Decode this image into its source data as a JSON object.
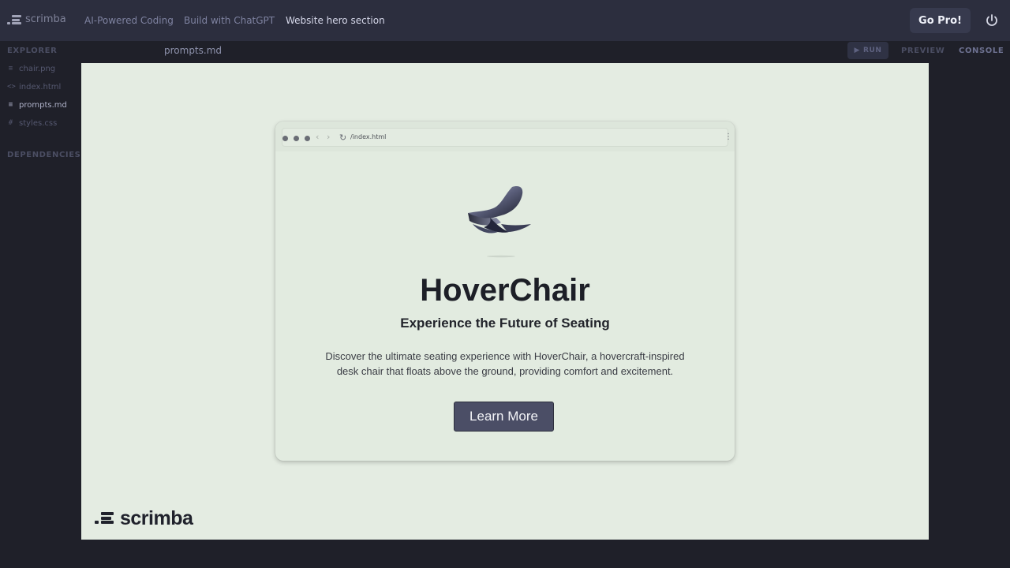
{
  "app": {
    "logo_text": "scrimba",
    "breadcrumbs": [
      "AI-Powered Coding",
      "Build with ChatGPT",
      "Website hero section"
    ],
    "go_pro_label": "Go Pro!",
    "power_icon": "power-icon"
  },
  "sidebar": {
    "explorer_label": "EXPLORER",
    "files": [
      {
        "icon": "≡",
        "name": "chair.png"
      },
      {
        "icon": "<>",
        "name": "index.html"
      },
      {
        "icon": "≡",
        "name": "prompts.md"
      },
      {
        "icon": "#",
        "name": "styles.css"
      }
    ],
    "dependencies_label": "DEPENDENCIES"
  },
  "editor": {
    "active_file": "prompts.md",
    "run_label": "RUN",
    "preview_label": "PREVIEW",
    "console_label": "CONSOLE"
  },
  "preview": {
    "browser": {
      "url": "/index.html"
    },
    "hero": {
      "title": "HoverChair",
      "subtitle": "Experience the Future of Seating",
      "description": "Discover the ultimate seating experience with HoverChair, a hovercraft-inspired desk chair that floats above the ground, providing comfort and excitement.",
      "cta_label": "Learn More"
    },
    "watermark": "scrimba"
  },
  "colors": {
    "topbar": "#2c2e3e",
    "background": "#1f2029",
    "preview_bg": "#e4ece2",
    "button": "#4b4e66"
  }
}
